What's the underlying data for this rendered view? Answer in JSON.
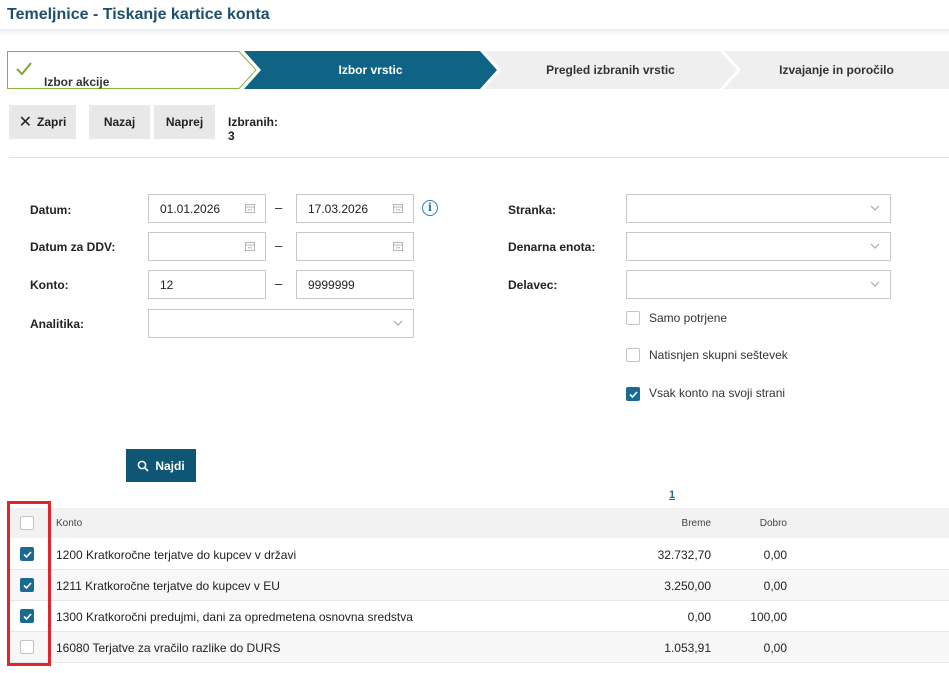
{
  "page": {
    "title": "Temeljnice - Tiskanje kartice konta"
  },
  "steps": [
    {
      "label": "Izbor akcije",
      "state": "done"
    },
    {
      "label": "Izbor vrstic",
      "state": "active"
    },
    {
      "label": "Pregled izbranih vrstic",
      "state": "pending"
    },
    {
      "label": "Izvajanje in poročilo",
      "state": "pending"
    }
  ],
  "toolbar": {
    "close_label": "Zapri",
    "back_label": "Nazaj",
    "next_label": "Naprej",
    "selected_label": "Izbranih: 3"
  },
  "form": {
    "date_label": "Datum:",
    "date_from": "01.01.2026",
    "date_to": "17.03.2026",
    "vat_date_label": "Datum za DDV:",
    "vat_date_from": "",
    "vat_date_to": "",
    "account_label": "Konto:",
    "account_from": "12",
    "account_to": "9999999",
    "analytics_label": "Analitika:",
    "analytics_value": "",
    "range_dash": "–",
    "customer_label": "Stranka:",
    "customer_value": "",
    "currency_label": "Denarna enota:",
    "currency_value": "",
    "employee_label": "Delavec:",
    "employee_value": "",
    "confirmed_only_label": "Samo potrjene",
    "confirmed_only_checked": false,
    "printed_total_label": "Natisnjen skupni seštevek",
    "printed_total_checked": false,
    "each_account_page_label": "Vsak konto na svoji strani",
    "each_account_page_checked": true,
    "search_label": "Najdi"
  },
  "pagination": {
    "current_page": "1"
  },
  "table": {
    "columns": {
      "account": "Konto",
      "debit": "Breme",
      "credit": "Dobro"
    },
    "rows": [
      {
        "account": "1200 Kratkoročne terjatve do kupcev v državi",
        "debit": "32.732,70",
        "credit": "0,00",
        "checked": true
      },
      {
        "account": "1211 Kratkoročne terjatve do kupcev v EU",
        "debit": "3.250,00",
        "credit": "0,00",
        "checked": true
      },
      {
        "account": "1300 Kratkoročni predujmi, dani za opredmetena osnovna sredstva",
        "debit": "0,00",
        "credit": "100,00",
        "checked": true
      },
      {
        "account": "16080 Terjatve za vračilo razlike do DURS",
        "debit": "1.053,91",
        "credit": "0,00",
        "checked": false
      }
    ]
  },
  "colors": {
    "brand": "#1e4f6e",
    "active_step": "#0f6485",
    "checkbox_on": "#1b6a92",
    "highlight": "#e0262c",
    "check_green": "#7cab2c"
  }
}
